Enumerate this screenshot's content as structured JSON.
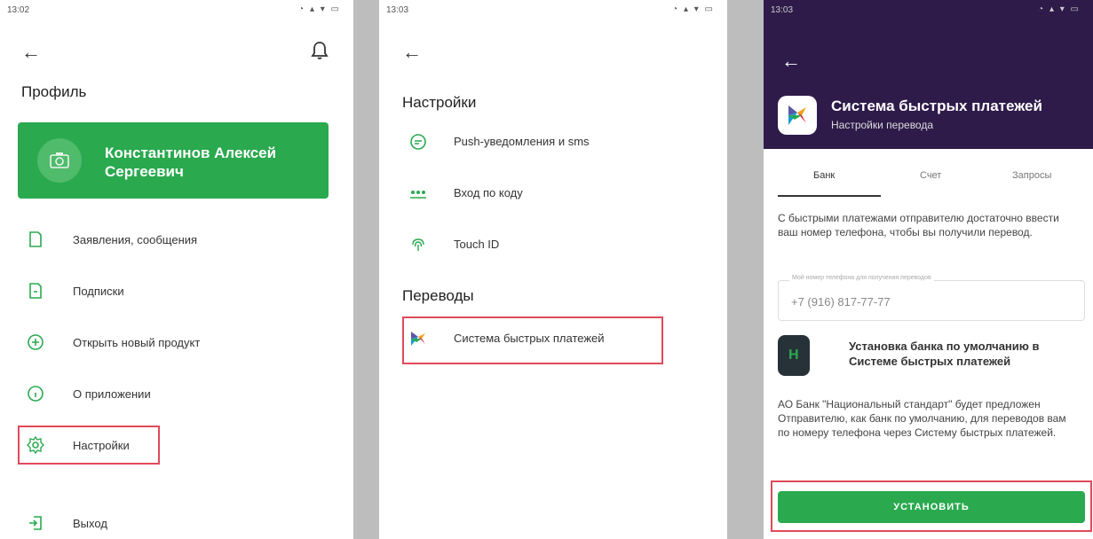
{
  "screen1": {
    "time": "13:02",
    "title": "Профиль",
    "profile_name": "Константинов Алексей Сергеевич",
    "menu": [
      {
        "label": "Заявления, сообщения"
      },
      {
        "label": "Подписки"
      },
      {
        "label": "Открыть новый продукт"
      },
      {
        "label": "О приложении"
      },
      {
        "label": "Настройки"
      },
      {
        "label": "Выход"
      }
    ]
  },
  "screen2": {
    "time": "13:03",
    "settings_title": "Настройки",
    "settings": [
      {
        "label": "Push-уведомления и sms"
      },
      {
        "label": "Вход по коду"
      },
      {
        "label": "Touch ID"
      }
    ],
    "transfers_title": "Переводы",
    "transfers": [
      {
        "label": "Система быстрых платежей"
      }
    ]
  },
  "screen3": {
    "time": "13:03",
    "title": "Система быстрых платежей",
    "subtitle": "Настройки перевода",
    "tabs": [
      "Банк",
      "Счет",
      "Запросы"
    ],
    "description": "С быстрыми платежами отправителю достаточно ввести ваш номер телефона, чтобы вы получили перевод.",
    "phone_label": "Мой номер телефона для получения переводов",
    "phone_value": "+7 (916) 817-77-77",
    "bank_logo_letter": "Н",
    "bank_default_title": "Установка банка по умолчанию в Системе быстрых платежей",
    "bank_description": "АО Банк \"Национальный стандарт\" будет предложен Отправителю, как банк по умолчанию, для переводов вам по номеру телефона через Систему быстрых платежей.",
    "install_button": "УСТАНОВИТЬ"
  },
  "colors": {
    "accent_green": "#2aa94f",
    "highlight_red": "#e04a5a",
    "sbp_header": "#2e1b4a"
  }
}
